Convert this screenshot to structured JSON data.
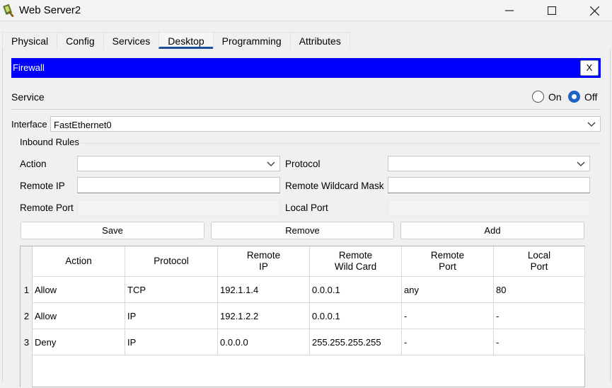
{
  "window": {
    "title": "Web Server2"
  },
  "tabs": [
    {
      "label": "Physical"
    },
    {
      "label": "Config"
    },
    {
      "label": "Services"
    },
    {
      "label": "Desktop"
    },
    {
      "label": "Programming"
    },
    {
      "label": "Attributes"
    }
  ],
  "active_tab": "Desktop",
  "firewall": {
    "title": "Firewall",
    "close_label": "X",
    "service_label": "Service",
    "on_label": "On",
    "off_label": "Off",
    "service_state": "Off",
    "interface_label": "Interface",
    "interface_value": "FastEthernet0",
    "inbound_rules_label": "Inbound Rules",
    "action_label": "Action",
    "action_value": "",
    "protocol_label": "Protocol",
    "protocol_value": "",
    "remote_ip_label": "Remote IP",
    "remote_ip_value": "",
    "remote_wildcard_label": "Remote Wildcard Mask",
    "remote_wildcard_value": "",
    "remote_port_label": "Remote Port",
    "local_port_label": "Local Port",
    "save_label": "Save",
    "remove_label": "Remove",
    "add_label": "Add"
  },
  "table": {
    "headers": [
      "Action",
      "Protocol",
      "Remote\nIP",
      "Remote\nWild Card",
      "Remote\nPort",
      "Local\nPort"
    ],
    "rows": [
      {
        "num": "1",
        "cells": [
          "Allow",
          "TCP",
          "192.1.1.4",
          "0.0.0.1",
          "any",
          "80"
        ]
      },
      {
        "num": "2",
        "cells": [
          "Allow",
          "IP",
          "192.1.2.2",
          "0.0.0.1",
          "-",
          "-"
        ]
      },
      {
        "num": "3",
        "cells": [
          "Deny",
          "IP",
          "0.0.0.0",
          "255.255.255.255",
          "-",
          "-"
        ]
      }
    ]
  },
  "colors": {
    "firewall_bar": "#0000ff",
    "active_tab_underline": "#1e4f9a",
    "radio_selected": "#1e63c7"
  }
}
